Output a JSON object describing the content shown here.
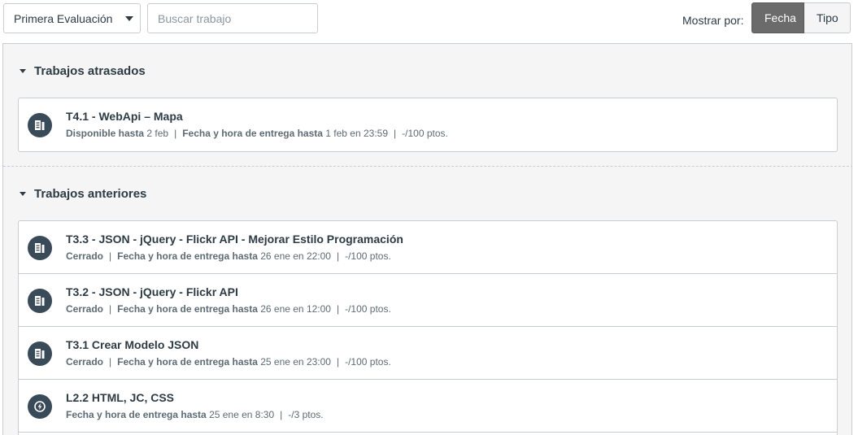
{
  "toolbar": {
    "grading_period": "Primera Evaluación",
    "search_placeholder": "Buscar trabajo",
    "show_by_label": "Mostrar por:",
    "date_button": "Fecha",
    "type_button": "Tipo"
  },
  "groups": {
    "overdue": {
      "title": "Trabajos atrasados",
      "items": [
        {
          "icon": "assignment-icon",
          "title": "T4.1 - WebApi – Mapa",
          "available_label": "Disponible hasta",
          "available_value": "2 feb",
          "due_label": "Fecha y hora de entrega hasta",
          "due_value": "1 feb en 23:59",
          "points": "-/100 ptos."
        }
      ]
    },
    "past": {
      "title": "Trabajos anteriores",
      "items": [
        {
          "icon": "assignment-icon",
          "title": "T3.3 - JSON - jQuery - Flickr API - Mejorar Estilo Programación",
          "status": "Cerrado",
          "due_label": "Fecha y hora de entrega hasta",
          "due_value": "26 ene en 22:00",
          "points": "-/100 ptos."
        },
        {
          "icon": "assignment-icon",
          "title": "T3.2 - JSON - jQuery - Flickr API",
          "status": "Cerrado",
          "due_label": "Fecha y hora de entrega hasta",
          "due_value": "26 ene en 12:00",
          "points": "-/100 ptos."
        },
        {
          "icon": "assignment-icon",
          "title": "T3.1 Crear Modelo JSON",
          "status": "Cerrado",
          "due_label": "Fecha y hora de entrega hasta",
          "due_value": "25 ene en 23:00",
          "points": "-/100 ptos."
        },
        {
          "icon": "external-tool-icon",
          "title": "L2.2 HTML, JC, CSS",
          "due_label": "Fecha y hora de entrega hasta",
          "due_value": "25 ene en 8:30",
          "points": "-/3 ptos."
        }
      ]
    }
  }
}
